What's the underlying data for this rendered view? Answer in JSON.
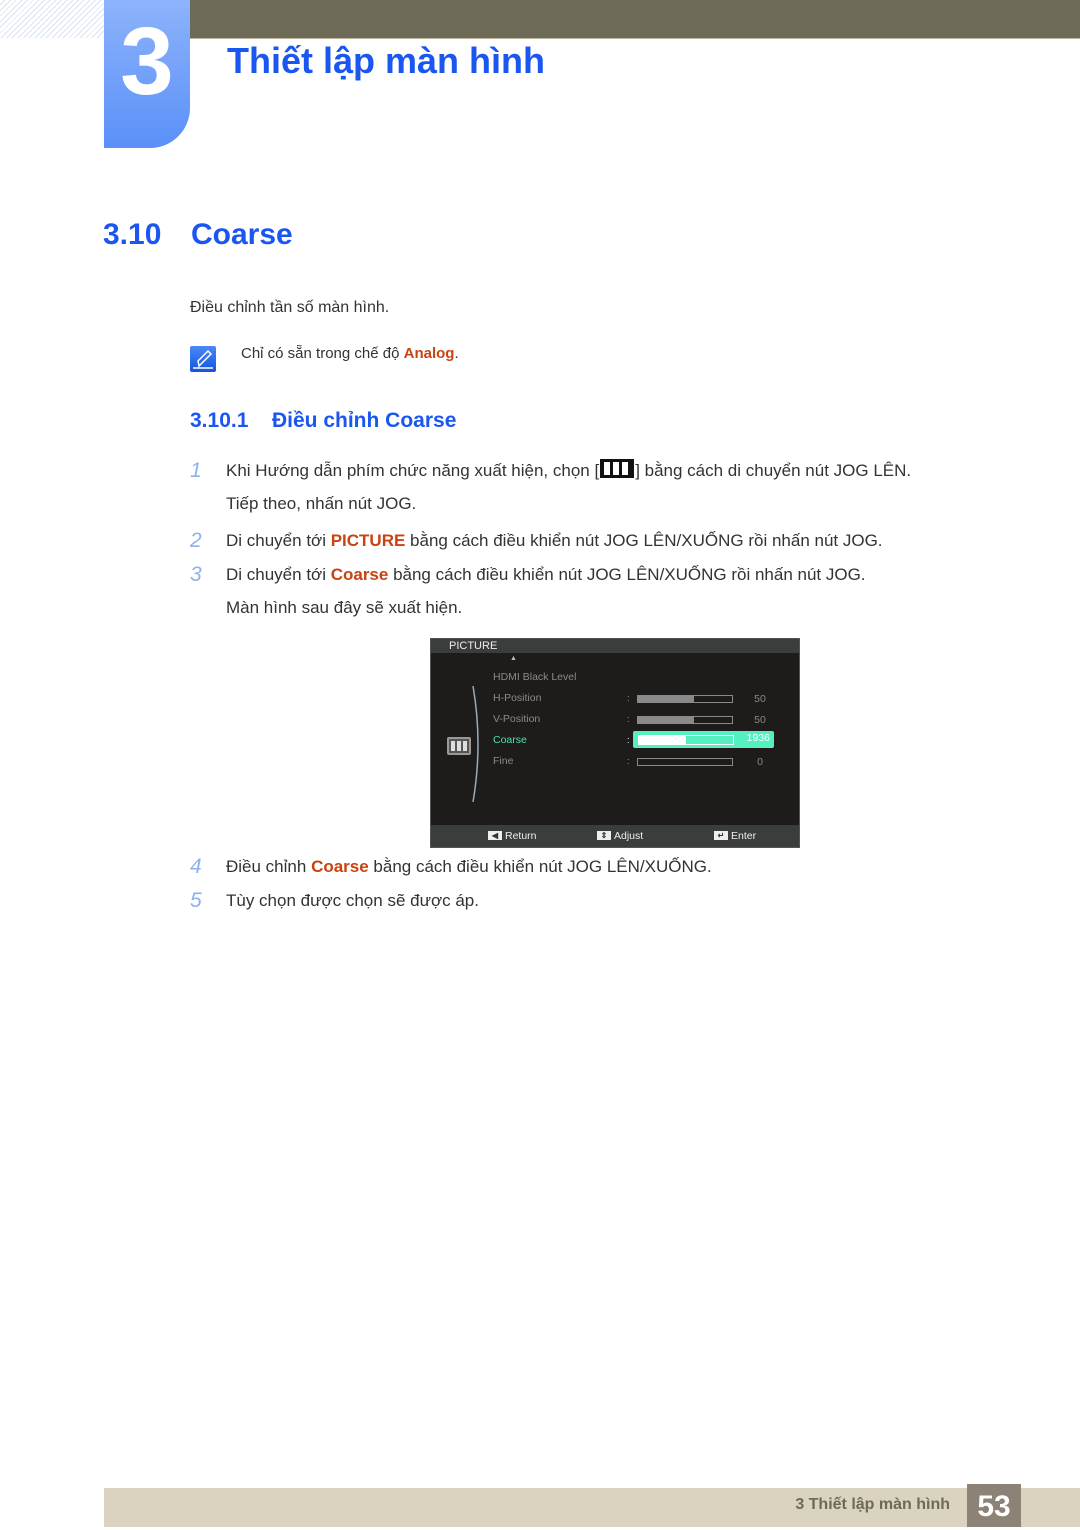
{
  "chapter": {
    "number": "3",
    "title": "Thiết lập màn hình"
  },
  "section": {
    "number": "3.10",
    "title": "Coarse"
  },
  "intro": "Điều chỉnh tần số màn hình.",
  "note": {
    "icon": "note-pencil-icon",
    "prefix": "Chỉ có sẵn trong chế độ ",
    "highlight": "Analog",
    "suffix": "."
  },
  "subsection": {
    "number": "3.10.1",
    "title": "Điều chỉnh Coarse"
  },
  "steps": [
    {
      "n": "1",
      "line1_pre": "Khi Hướng dẫn phím chức năng xuất hiện, chọn [",
      "line1_icon": "menu-bars-icon",
      "line1_post": "] bằng cách di chuyển nút JOG LÊN.",
      "line2": "Tiếp theo, nhấn nút JOG."
    },
    {
      "n": "2",
      "pre": "Di chuyển tới ",
      "highlight": "PICTURE",
      "post": " bằng cách điều khiển nút JOG LÊN/XUỐNG rồi nhấn nút JOG."
    },
    {
      "n": "3",
      "pre": "Di chuyển tới ",
      "highlight": "Coarse",
      "post": " bằng cách điều khiển nút JOG LÊN/XUỐNG rồi nhấn nút JOG.",
      "line2": "Màn hình sau đây sẽ xuất hiện."
    },
    {
      "n": "4",
      "pre": "Điều chỉnh ",
      "highlight": "Coarse",
      "post": " bằng cách điều khiển nút JOG LÊN/XUỐNG."
    },
    {
      "n": "5",
      "text": "Tùy chọn được chọn sẽ được áp."
    }
  ],
  "osd": {
    "header": "PICTURE",
    "items": [
      {
        "label": "HDMI Black Level"
      },
      {
        "label": "H-Position",
        "value": "50",
        "fraction": 0.6
      },
      {
        "label": "V-Position",
        "value": "50",
        "fraction": 0.6
      },
      {
        "label": "Coarse",
        "value": "1936",
        "fraction": 0.5,
        "active": true
      },
      {
        "label": "Fine",
        "value": "0",
        "fraction": 0
      }
    ],
    "footer": [
      {
        "icon": "return-icon",
        "label": "Return"
      },
      {
        "icon": "adjust-icon",
        "label": "Adjust"
      },
      {
        "icon": "enter-icon",
        "label": "Enter"
      }
    ]
  },
  "footer": {
    "chapter_label": "3 Thiết lập màn hình",
    "page": "53"
  },
  "colors": {
    "heading_blue": "#1a56f0",
    "highlight_orange": "#c94310",
    "osd_active": "#55f0c0",
    "top_bar": "#6d6b57",
    "footer_bar": "#d9d3bf",
    "page_box": "#8c8275"
  }
}
